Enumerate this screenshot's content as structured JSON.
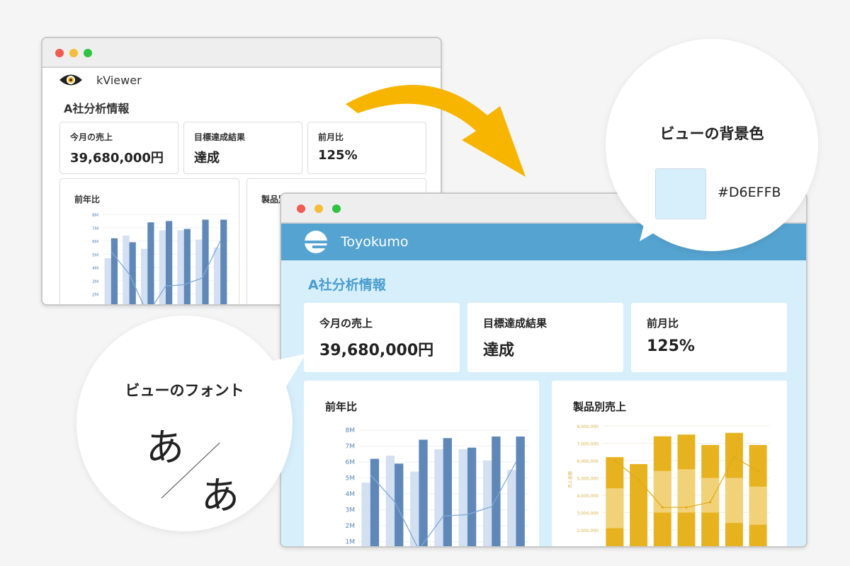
{
  "colors": {
    "page_bg": "#f5f5f5",
    "view_bg": "#D6EFFB",
    "header_blue": "#55a3d0",
    "title_blue": "#4a9dcf",
    "arrow_yellow": "#f7b500",
    "bar_dark_blue": "#5f88b8",
    "bar_light_blue": "#d3e0f2",
    "bar_gold": "#e6b21f",
    "bar_gold_light": "#f1d278"
  },
  "back_window": {
    "app_name": "kViewer",
    "logo_icon": "eye-logo-icon",
    "page_title": "A社分析情報",
    "cards": [
      {
        "title": "今月の売上",
        "value": "39,680,000円"
      },
      {
        "title": "目標達成結果",
        "value": "達成"
      },
      {
        "title": "前月比",
        "value": "125%"
      }
    ],
    "panels": [
      {
        "title": "前年比"
      },
      {
        "title": "製品別"
      }
    ]
  },
  "front_window": {
    "app_name": "Toyokumo",
    "logo_icon": "toyokumo-logo-icon",
    "page_title": "A社分析情報",
    "cards": [
      {
        "title": "今月の売上",
        "value": "39,680,000円"
      },
      {
        "title": "目標達成結果",
        "value": "達成"
      },
      {
        "title": "前月比",
        "value": "125%"
      }
    ],
    "panels": [
      {
        "title": "前年比"
      },
      {
        "title": "製品別売上"
      }
    ]
  },
  "callouts": {
    "background": {
      "title": "ビューの背景色",
      "hex": "#D6EFFB"
    },
    "font": {
      "title": "ビューのフォント",
      "glyph_before": "あ",
      "glyph_after": "あ"
    }
  },
  "chart_data": [
    {
      "type": "bar",
      "title": "前年比",
      "yticks": [
        "8M",
        "7M",
        "6M",
        "5M",
        "4M",
        "3M",
        "2M",
        "1M"
      ],
      "ylim": [
        0,
        8
      ],
      "series": [
        {
          "values": [
            4.7,
            6.4,
            5.4,
            6.8,
            6.8,
            6.1,
            5.5
          ]
        },
        {
          "values": [
            6.2,
            5.9,
            7.4,
            7.5,
            6.9,
            7.6,
            7.6
          ]
        },
        {
          "values": [
            5.2,
            3.5,
            0.5,
            2.6,
            2.7,
            3.2,
            6.0
          ]
        }
      ]
    },
    {
      "type": "bar",
      "title": "製品別売上",
      "yticks": [
        "8,000,000",
        "7,000,000",
        "6,000,000",
        "5,000,000",
        "4,000,000",
        "3,000,000",
        "2,000,000",
        "1,000,000"
      ],
      "ylabel": "売上金額",
      "ylim": [
        0,
        8000000
      ],
      "stacks": [
        [
          2100000,
          2300000,
          1800000,
          6200000
        ],
        [
          2400000,
          0,
          2300000,
          5800000
        ],
        [
          3000000,
          2400000,
          2000000,
          7400000
        ],
        [
          3000000,
          2500000,
          2000000,
          7500000
        ],
        [
          3000000,
          2000000,
          1900000,
          6900000
        ],
        [
          2400000,
          2600000,
          2600000,
          7600000
        ],
        [
          2300000,
          2200000,
          2400000,
          6900000
        ]
      ],
      "line": [
        6000000,
        4900000,
        3300000,
        3300000,
        3600000,
        6200000,
        5400000
      ]
    }
  ]
}
